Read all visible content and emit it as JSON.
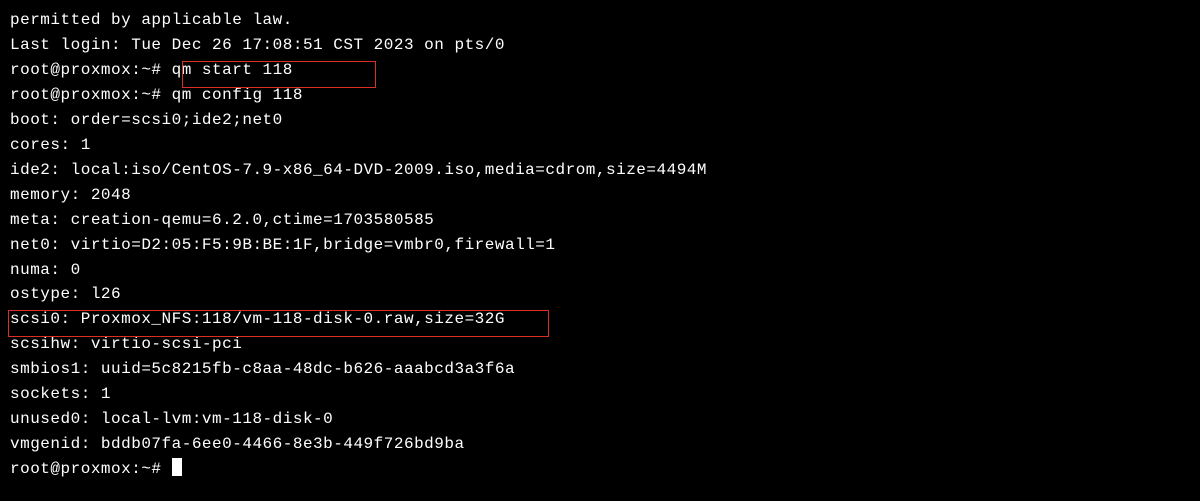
{
  "lines": {
    "l0": "permitted by applicable law.",
    "l1": "Last login: Tue Dec 26 17:08:51 CST 2023 on pts/0",
    "l2": "root@proxmox:~# qm start 118",
    "l3": "root@proxmox:~# qm config 118",
    "l4": "boot: order=scsi0;ide2;net0",
    "l5": "cores: 1",
    "l6": "ide2: local:iso/CentOS-7.9-x86_64-DVD-2009.iso,media=cdrom,size=4494M",
    "l7": "memory: 2048",
    "l8": "meta: creation-qemu=6.2.0,ctime=1703580585",
    "l9": "net0: virtio=D2:05:F5:9B:BE:1F,bridge=vmbr0,firewall=1",
    "l10": "numa: 0",
    "l11": "ostype: l26",
    "l12": "scsi0: Proxmox_NFS:118/vm-118-disk-0.raw,size=32G",
    "l13": "scsihw: virtio-scsi-pci",
    "l14": "smbios1: uuid=5c8215fb-c8aa-48dc-b626-aaabcd3a3f6a",
    "l15": "sockets: 1",
    "l16": "unused0: local-lvm:vm-118-disk-0",
    "l17": "vmgenid: bddb07fa-6ee0-4466-8e3b-449f726bd9ba",
    "l18": "root@proxmox:~# "
  }
}
